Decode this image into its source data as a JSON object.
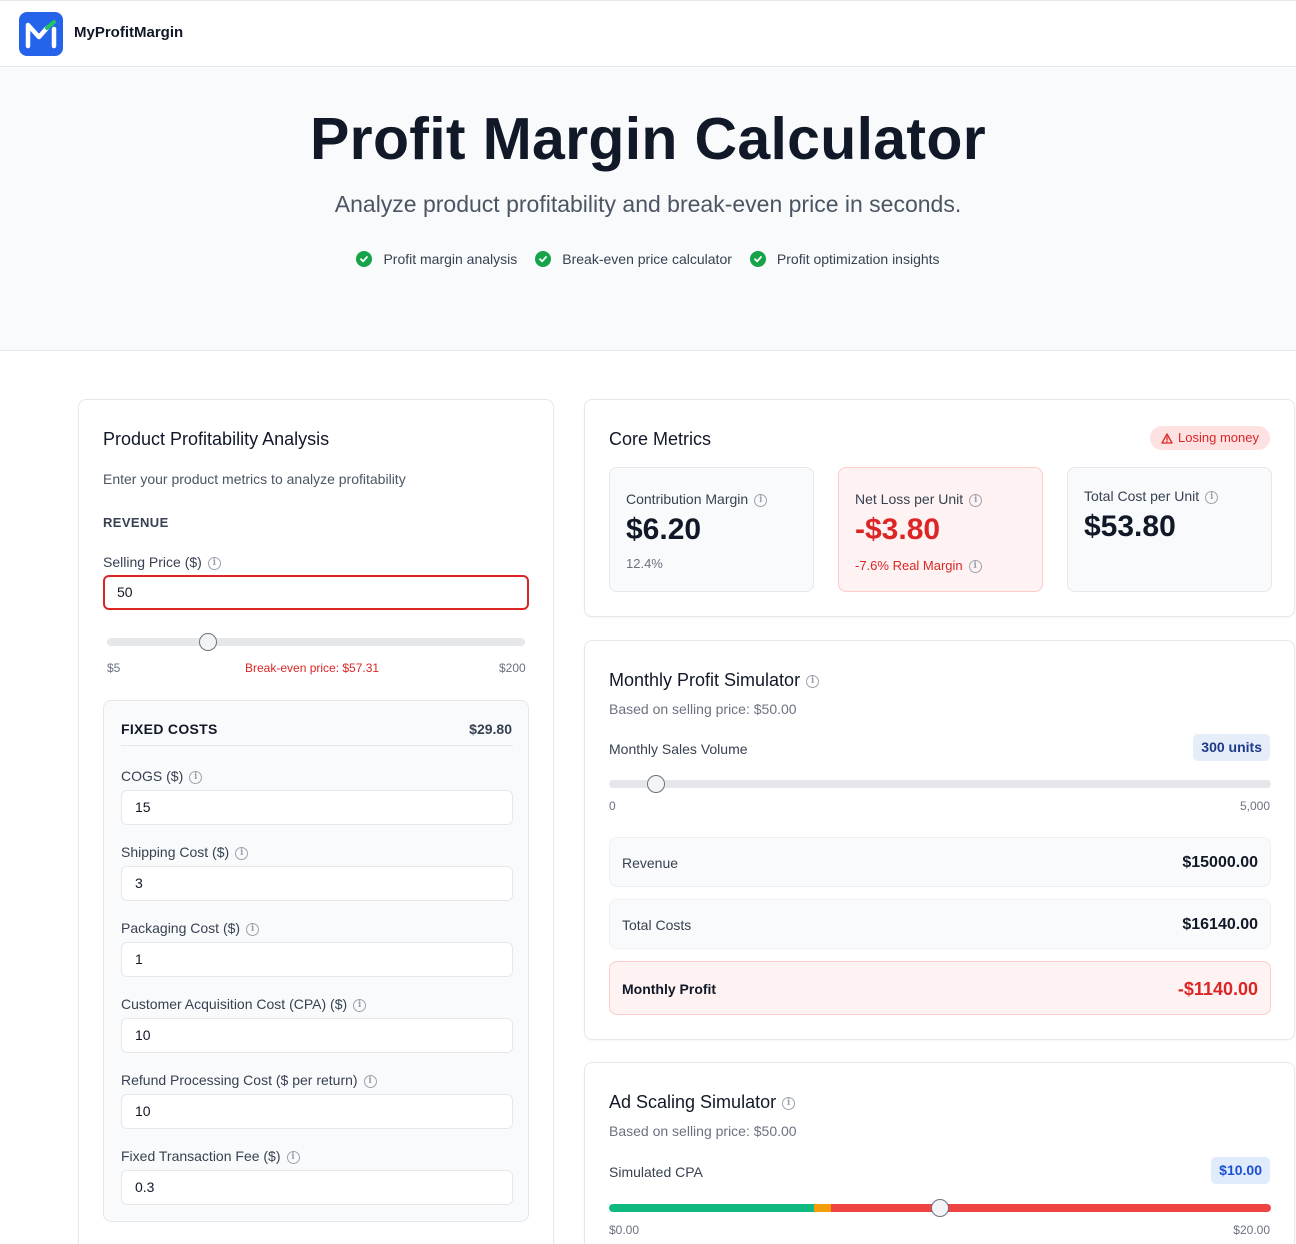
{
  "header": {
    "brand": "MyProfitMargin",
    "logo_icon": "m-chart-logo-icon",
    "logo_color": "#2563eb"
  },
  "hero": {
    "title": "Profit Margin Calculator",
    "subtitle": "Analyze product profitability and break-even price in seconds.",
    "features": [
      "Profit margin analysis",
      "Break-even price calculator",
      "Profit optimization insights"
    ]
  },
  "analysis": {
    "title": "Product Profitability Analysis",
    "description": "Enter your product metrics to analyze profitability",
    "revenue_heading": "REVENUE",
    "selling_price_label": "Selling Price ($)",
    "selling_price_value": "50",
    "slider": {
      "min": "$5",
      "max": "$200",
      "breakeven": "Break-even price: $57.31",
      "value": 50,
      "range": [
        5,
        200
      ]
    },
    "fixed_costs": {
      "heading": "FIXED COSTS",
      "total": "$29.80",
      "fields": [
        {
          "label": "COGS ($)",
          "value": "15"
        },
        {
          "label": "Shipping Cost ($)",
          "value": "3"
        },
        {
          "label": "Packaging Cost ($)",
          "value": "1"
        },
        {
          "label": "Customer Acquisition Cost (CPA) ($)",
          "value": "10"
        },
        {
          "label": "Refund Processing Cost ($ per return)",
          "value": "10"
        },
        {
          "label": "Fixed Transaction Fee ($)",
          "value": "0.3"
        }
      ]
    }
  },
  "core": {
    "title": "Core Metrics",
    "status": "Losing money",
    "status_icon": "warning-icon",
    "metrics": [
      {
        "label": "Contribution Margin",
        "value": "$6.20",
        "sub": "12.4%"
      },
      {
        "label": "Net Loss per Unit",
        "value": "-$3.80",
        "sub": "-7.6% Real Margin"
      },
      {
        "label": "Total Cost per Unit",
        "value": "$53.80",
        "sub": ""
      }
    ]
  },
  "monthly": {
    "title": "Monthly Profit Simulator",
    "based_on": "Based on selling price: $50.00",
    "volume_label": "Monthly Sales Volume",
    "volume_badge": "300 units",
    "slider": {
      "min": "0",
      "max": "5,000",
      "value": 300,
      "range": [
        0,
        5000
      ]
    },
    "rows": [
      {
        "label": "Revenue",
        "value": "$15000.00"
      },
      {
        "label": "Total Costs",
        "value": "$16140.00"
      }
    ],
    "profit": {
      "label": "Monthly Profit",
      "value": "-$1140.00"
    }
  },
  "ads": {
    "title": "Ad Scaling Simulator",
    "based_on": "Based on selling price: $50.00",
    "cpa_label": "Simulated CPA",
    "cpa_badge": "$10.00",
    "slider": {
      "min": "$0.00",
      "max": "$20.00",
      "value": 10,
      "range": [
        0,
        20
      ]
    }
  },
  "colors": {
    "loss": "#dc2626",
    "profit_zone": "#10b981",
    "warn_zone": "#f59e0b",
    "danger_zone": "#ef4444",
    "badge_blue": "#1e40af"
  }
}
